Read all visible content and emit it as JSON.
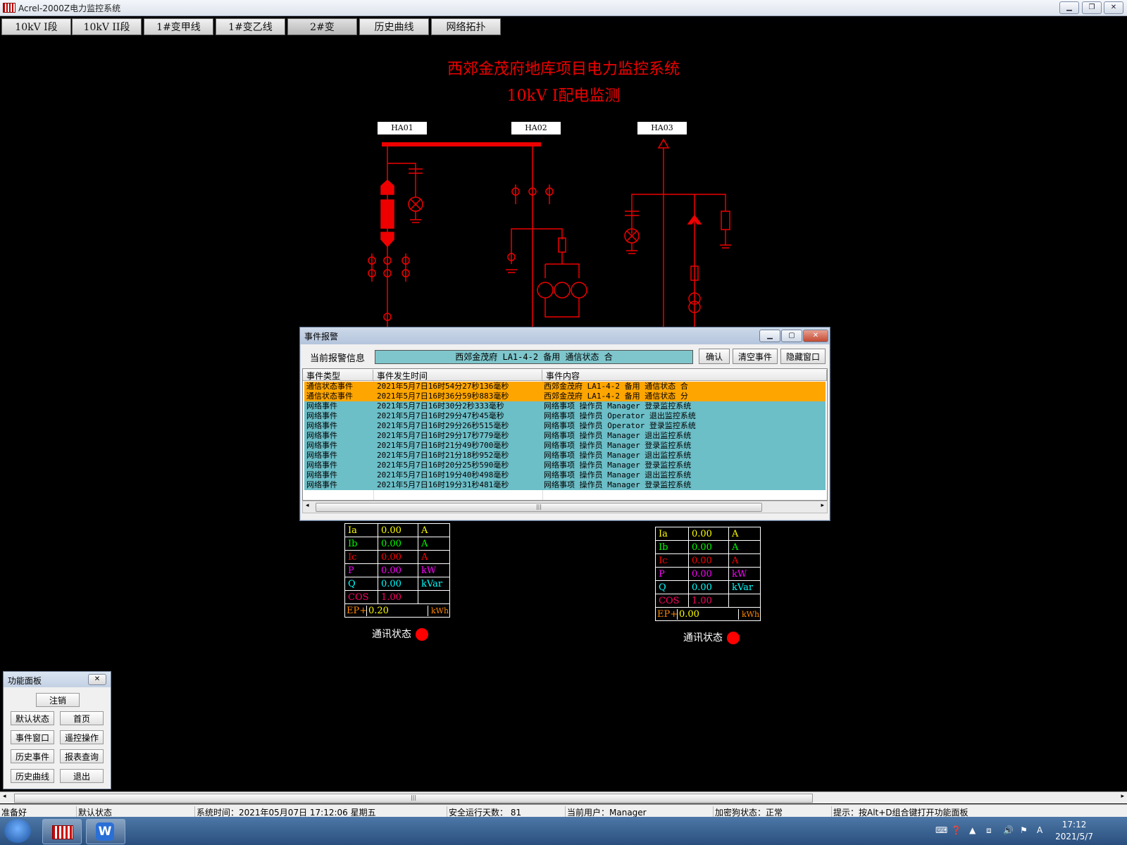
{
  "window": {
    "title": "Acrel-2000Z电力监控系统"
  },
  "menu": [
    "10kV  I段",
    "10kV  II段",
    "1#变甲线",
    "1#变乙线",
    "2#变",
    "历史曲线",
    "网络拓扑"
  ],
  "diagram": {
    "title": "西郊金茂府地库项目电力监控系统",
    "subtitle": "10kV  I配电监测",
    "labels": [
      "HA01",
      "HA02",
      "HA03"
    ]
  },
  "meas_left": {
    "rows": [
      {
        "name": "Ia",
        "value": "0.00",
        "unit": "A"
      },
      {
        "name": "Ib",
        "value": "0.00",
        "unit": "A"
      },
      {
        "name": "Ic",
        "value": "0.00",
        "unit": "A"
      },
      {
        "name": "P",
        "value": "0.00",
        "unit": "kW"
      },
      {
        "name": "Q",
        "value": "0.00",
        "unit": "kVar"
      },
      {
        "name": "COS",
        "value": "1.00",
        "unit": ""
      }
    ],
    "ep_name": "EP+",
    "ep_value": "0.20",
    "ep_unit": "kWh",
    "comm_label": "通讯状态"
  },
  "meas_right": {
    "rows": [
      {
        "name": "Ia",
        "value": "0.00",
        "unit": "A"
      },
      {
        "name": "Ib",
        "value": "0.00",
        "unit": "A"
      },
      {
        "name": "Ic",
        "value": "0.00",
        "unit": "A"
      },
      {
        "name": "P",
        "value": "0.00",
        "unit": "kW"
      },
      {
        "name": "Q",
        "value": "0.00",
        "unit": "kVar"
      },
      {
        "name": "COS",
        "value": "1.00",
        "unit": ""
      }
    ],
    "ep_name": "EP+",
    "ep_value": "0.00",
    "ep_unit": "kWh",
    "comm_label": "通讯状态"
  },
  "event_dialog": {
    "title": "事件报警",
    "current_label": "当前报警信息",
    "current_value": "西郊金茂府 LA1-4-2 备用 通信状态 合",
    "btn_confirm": "确认",
    "btn_clear": "清空事件",
    "btn_hide": "隐藏窗口",
    "columns": [
      "事件类型",
      "事件发生时间",
      "事件内容"
    ],
    "rows": [
      {
        "type": "通信状态事件",
        "time": "2021年5月7日16时54分27秒136毫秒",
        "content": "西郊金茂府 LA1-4-2 备用 通信状态 合",
        "color": "#ffa500"
      },
      {
        "type": "通信状态事件",
        "time": "2021年5月7日16时36分59秒883毫秒",
        "content": "西郊金茂府 LA1-4-2 备用 通信状态 分",
        "color": "#ffa500"
      },
      {
        "type": "网络事件",
        "time": "2021年5月7日16时30分2秒333毫秒",
        "content": "网络事项 操作员 Manager 登录监控系统",
        "color": "#6cbec7"
      },
      {
        "type": "网络事件",
        "time": "2021年5月7日16时29分47秒45毫秒",
        "content": "网络事项 操作员 Operator 退出监控系统",
        "color": "#6cbec7"
      },
      {
        "type": "网络事件",
        "time": "2021年5月7日16时29分26秒515毫秒",
        "content": "网络事项 操作员 Operator 登录监控系统",
        "color": "#6cbec7"
      },
      {
        "type": "网络事件",
        "time": "2021年5月7日16时29分17秒779毫秒",
        "content": "网络事项 操作员 Manager 退出监控系统",
        "color": "#6cbec7"
      },
      {
        "type": "网络事件",
        "time": "2021年5月7日16时21分49秒700毫秒",
        "content": "网络事项 操作员 Manager 登录监控系统",
        "color": "#6cbec7"
      },
      {
        "type": "网络事件",
        "time": "2021年5月7日16时21分18秒952毫秒",
        "content": "网络事项 操作员 Manager 退出监控系统",
        "color": "#6cbec7"
      },
      {
        "type": "网络事件",
        "time": "2021年5月7日16时20分25秒590毫秒",
        "content": "网络事项 操作员 Manager 登录监控系统",
        "color": "#6cbec7"
      },
      {
        "type": "网络事件",
        "time": "2021年5月7日16时19分40秒498毫秒",
        "content": "网络事项 操作员 Manager 退出监控系统",
        "color": "#6cbec7"
      },
      {
        "type": "网络事件",
        "time": "2021年5月7日16时19分31秒481毫秒",
        "content": "网络事项 操作员 Manager 登录监控系统",
        "color": "#6cbec7"
      }
    ]
  },
  "func_panel": {
    "title": "功能面板",
    "buttons": [
      "注销",
      "默认状态",
      "首页",
      "事件窗口",
      "遥控操作",
      "历史事件",
      "报表查询",
      "历史曲线",
      "退出"
    ]
  },
  "status": {
    "ready": "准备好",
    "mode": "默认状态",
    "time": "系统时间：2021年05月07日  17:12:06   星期五",
    "days": "安全运行天数： 81",
    "user": "当前用户：Manager",
    "dongle": "加密狗状态：正常",
    "hint": "提示：按Alt+D组合键打开功能面板"
  },
  "taskbar": {
    "time": "17:12",
    "date": "2021/5/7"
  },
  "colors": {
    "diagram": "#e00000",
    "orange_row": "#ffa500",
    "cyan_row": "#6cbec7"
  }
}
